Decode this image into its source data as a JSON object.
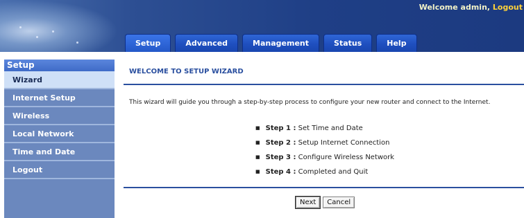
{
  "header": {
    "welcome_text": "Welcome admin, ",
    "logout_link": "Logout"
  },
  "tabs": [
    {
      "label": "Setup"
    },
    {
      "label": "Advanced"
    },
    {
      "label": "Management"
    },
    {
      "label": "Status"
    },
    {
      "label": "Help"
    }
  ],
  "sidebar": {
    "title": "Setup",
    "items": [
      {
        "label": "Wizard"
      },
      {
        "label": "Internet Setup"
      },
      {
        "label": "Wireless"
      },
      {
        "label": "Local Network"
      },
      {
        "label": "Time and Date"
      },
      {
        "label": "Logout"
      }
    ]
  },
  "main": {
    "title": "WELCOME TO SETUP WIZARD",
    "intro": "This wizard will guide you through a step-by-step process to configure your new router and connect to the Internet.",
    "steps": [
      {
        "step": "Step 1 :",
        "text": " Set Time and Date"
      },
      {
        "step": "Step 2 :",
        "text": " Setup Internet Connection"
      },
      {
        "step": "Step 3 :",
        "text": " Configure Wireless Network"
      },
      {
        "step": "Step 4 :",
        "text": " Completed and Quit"
      }
    ],
    "next_label": "Next",
    "cancel_label": "Cancel"
  },
  "colors": {
    "header_blue": "#1f3f86",
    "tab_blue": "#1f4fbf",
    "sidebar_bg": "#6b88be",
    "active_item_bg": "#cfe0f7",
    "title_blue": "#2a4f9f",
    "welcome_text": "#f3f3c8",
    "logout_link": "#ffd23a"
  }
}
